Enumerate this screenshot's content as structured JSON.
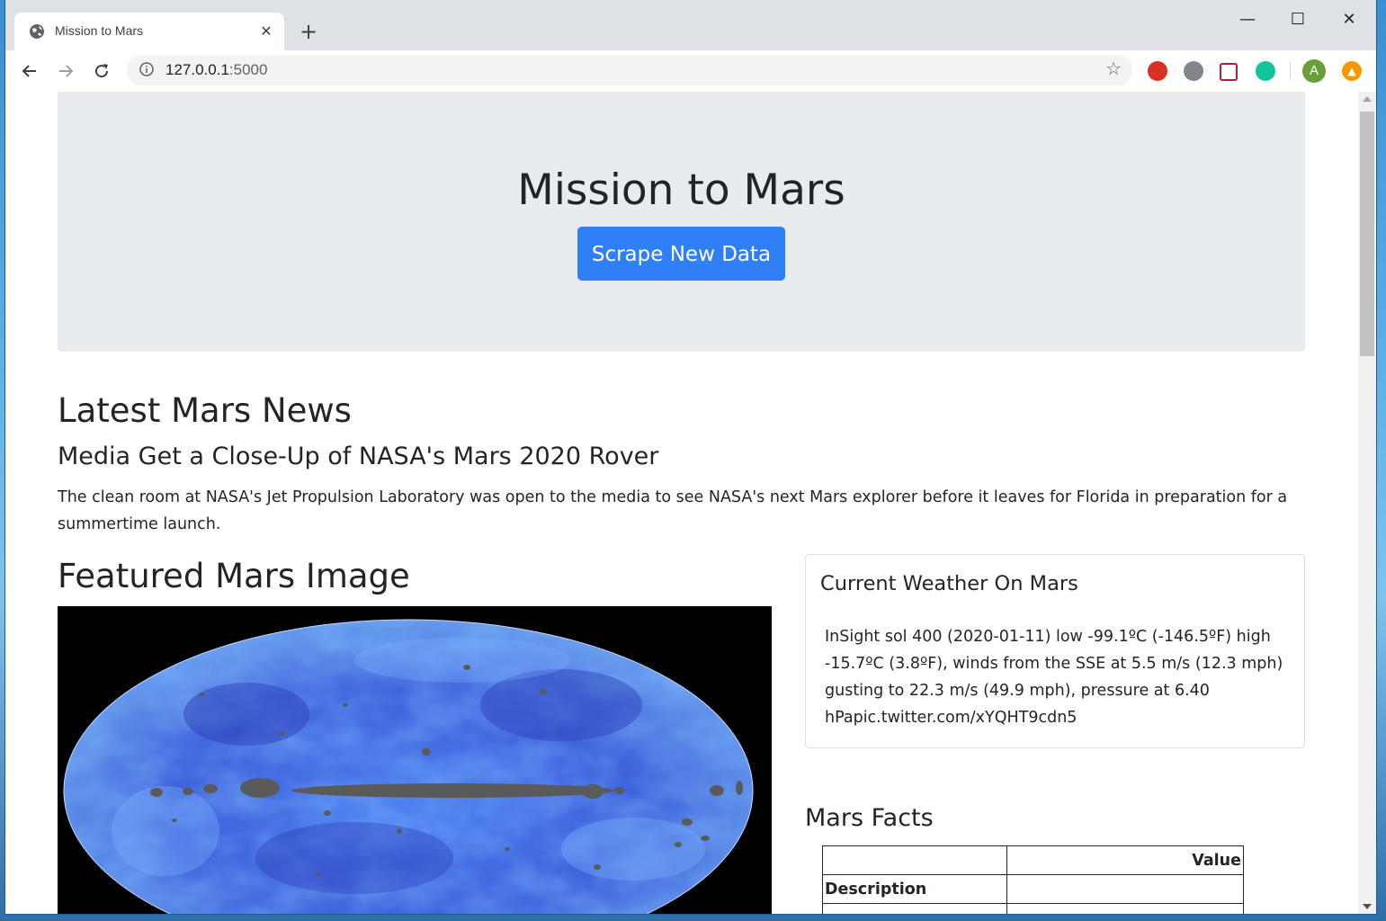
{
  "browser": {
    "tab_title": "Mission to Mars",
    "tab_close": "✕",
    "new_tab": "+",
    "url_host": "127.0.0.1",
    "url_port": ":5000",
    "profile_initial": "A",
    "window_controls": {
      "minimize": "—",
      "maximize": "☐",
      "close": "✕"
    }
  },
  "jumbotron": {
    "title": "Mission to Mars",
    "button_label": "Scrape New Data",
    "button_color": "#2f7ff7"
  },
  "news": {
    "heading": "Latest Mars News",
    "title": "Media Get a Close-Up of NASA's Mars 2020 Rover",
    "body": "The clean room at NASA's Jet Propulsion Laboratory was open to the media to see NASA's next Mars explorer before it leaves for Florida in preparation for a summertime launch."
  },
  "featured": {
    "heading": "Featured Mars Image",
    "image_kind": "all-sky-map"
  },
  "weather": {
    "heading": "Current Weather On Mars",
    "text": "InSight sol 400 (2020-01-11) low -99.1ºC (-146.5ºF) high -15.7ºC (3.8ºF), winds from the SSE at 5.5 m/s (12.3 mph) gusting to 22.3 m/s (49.9 mph), pressure at 6.40 hPapic.twitter.com/xYQHT9cdn5"
  },
  "facts": {
    "heading": "Mars Facts",
    "header": [
      "",
      "Value"
    ],
    "rows": [
      [
        "Description",
        ""
      ]
    ]
  },
  "icons": {
    "favicon": "globe-icon",
    "back": "arrow-left-icon",
    "forward": "arrow-right-icon",
    "reload": "reload-icon",
    "info": "info-icon",
    "bookmark": "star-icon",
    "extensions": [
      "adblock-icon",
      "skype-icon",
      "pocket-icon",
      "grammarly-icon"
    ],
    "update": "update-icon"
  }
}
